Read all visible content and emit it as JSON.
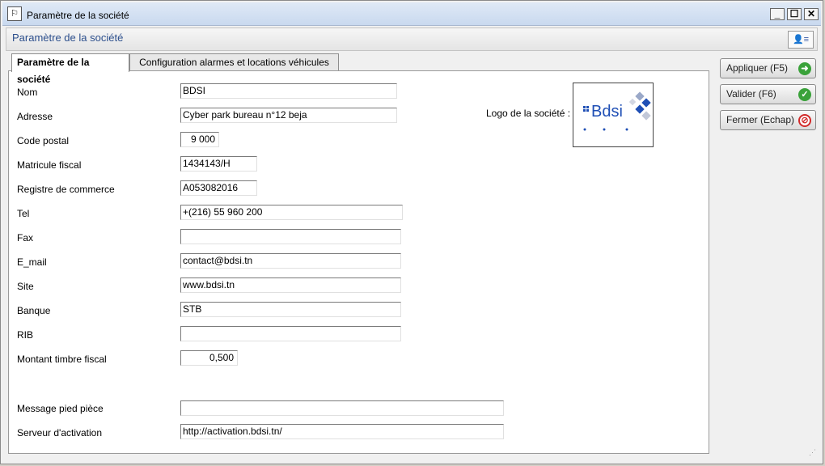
{
  "window": {
    "title": "Paramètre de la société",
    "minimize": "_",
    "maximize": "☐",
    "close": "✕"
  },
  "header": {
    "title": "Paramètre de la société"
  },
  "tabs": [
    {
      "label": "Paramètre de la société"
    },
    {
      "label": "Configuration alarmes et locations véhicules"
    }
  ],
  "form": {
    "fields": [
      {
        "label": "Nom",
        "value": "BDSI"
      },
      {
        "label": "Adresse",
        "value": "Cyber park bureau n°12 beja"
      },
      {
        "label": "Code postal",
        "value": "9 000"
      },
      {
        "label": "Matricule fiscal",
        "value": "1434143/H"
      },
      {
        "label": "Registre de commerce",
        "value": "A053082016"
      },
      {
        "label": "Tel",
        "value": "+(216) 55 960 200"
      },
      {
        "label": "Fax",
        "value": ""
      },
      {
        "label": "E_mail",
        "value": "contact@bdsi.tn"
      },
      {
        "label": "Site",
        "value": "www.bdsi.tn"
      },
      {
        "label": "Banque",
        "value": "STB"
      },
      {
        "label": "RIB",
        "value": ""
      },
      {
        "label": "Montant timbre fiscal",
        "value": "0,500"
      },
      {
        "label": "Message pied pièce",
        "value": ""
      },
      {
        "label": "Serveur d'activation",
        "value": "http://activation.bdsi.tn/"
      }
    ],
    "logo_label": "Logo de la société :"
  },
  "logo": {
    "text": "Bdsi",
    "color": "#1f4fb5"
  },
  "actions": {
    "apply": "Appliquer (F5)",
    "validate": "Valider (F6)",
    "close": "Fermer (Echap)"
  },
  "colors": {
    "green": "#3aa23a",
    "red": "#d22a2a"
  }
}
